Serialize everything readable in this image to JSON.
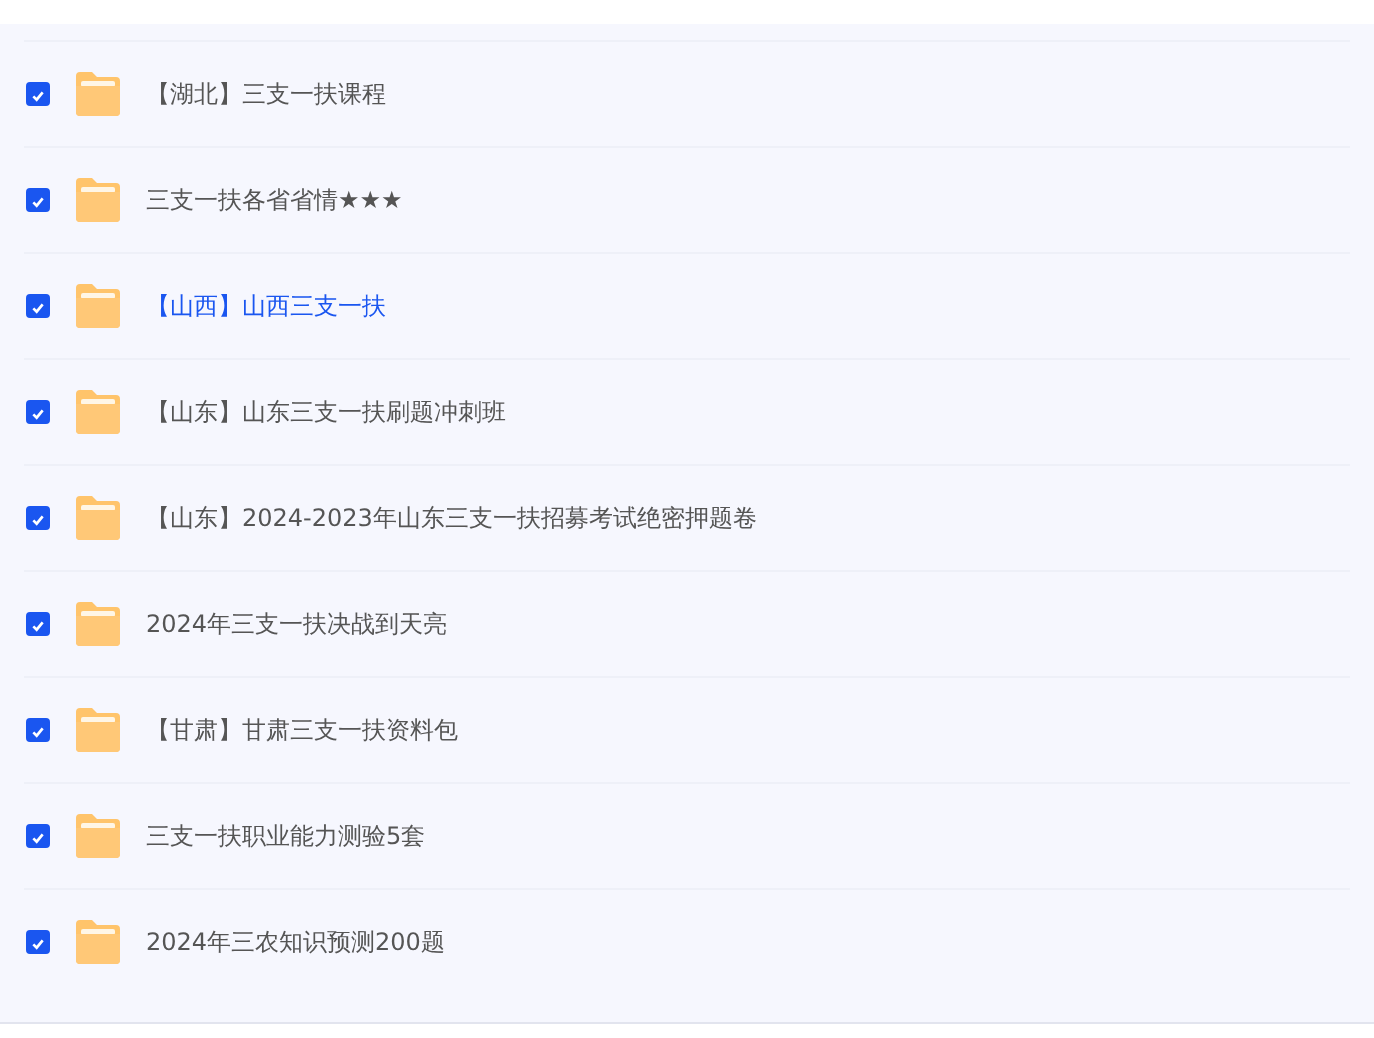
{
  "files": [
    {
      "name": "【湖北】三支一扶课程",
      "checked": true,
      "hovered": false
    },
    {
      "name": "三支一扶各省省情★★★",
      "checked": true,
      "hovered": false
    },
    {
      "name": "【山西】山西三支一扶",
      "checked": true,
      "hovered": true
    },
    {
      "name": "【山东】山东三支一扶刷题冲刺班",
      "checked": true,
      "hovered": false
    },
    {
      "name": "【山东】2024-2023年山东三支一扶招募考试绝密押题卷",
      "checked": true,
      "hovered": false
    },
    {
      "name": "2024年三支一扶决战到天亮",
      "checked": true,
      "hovered": false
    },
    {
      "name": "【甘肃】甘肃三支一扶资料包",
      "checked": true,
      "hovered": false
    },
    {
      "name": "三支一扶职业能力测验5套",
      "checked": true,
      "hovered": false
    },
    {
      "name": "2024年三农知识预测200题",
      "checked": true,
      "hovered": false
    }
  ]
}
